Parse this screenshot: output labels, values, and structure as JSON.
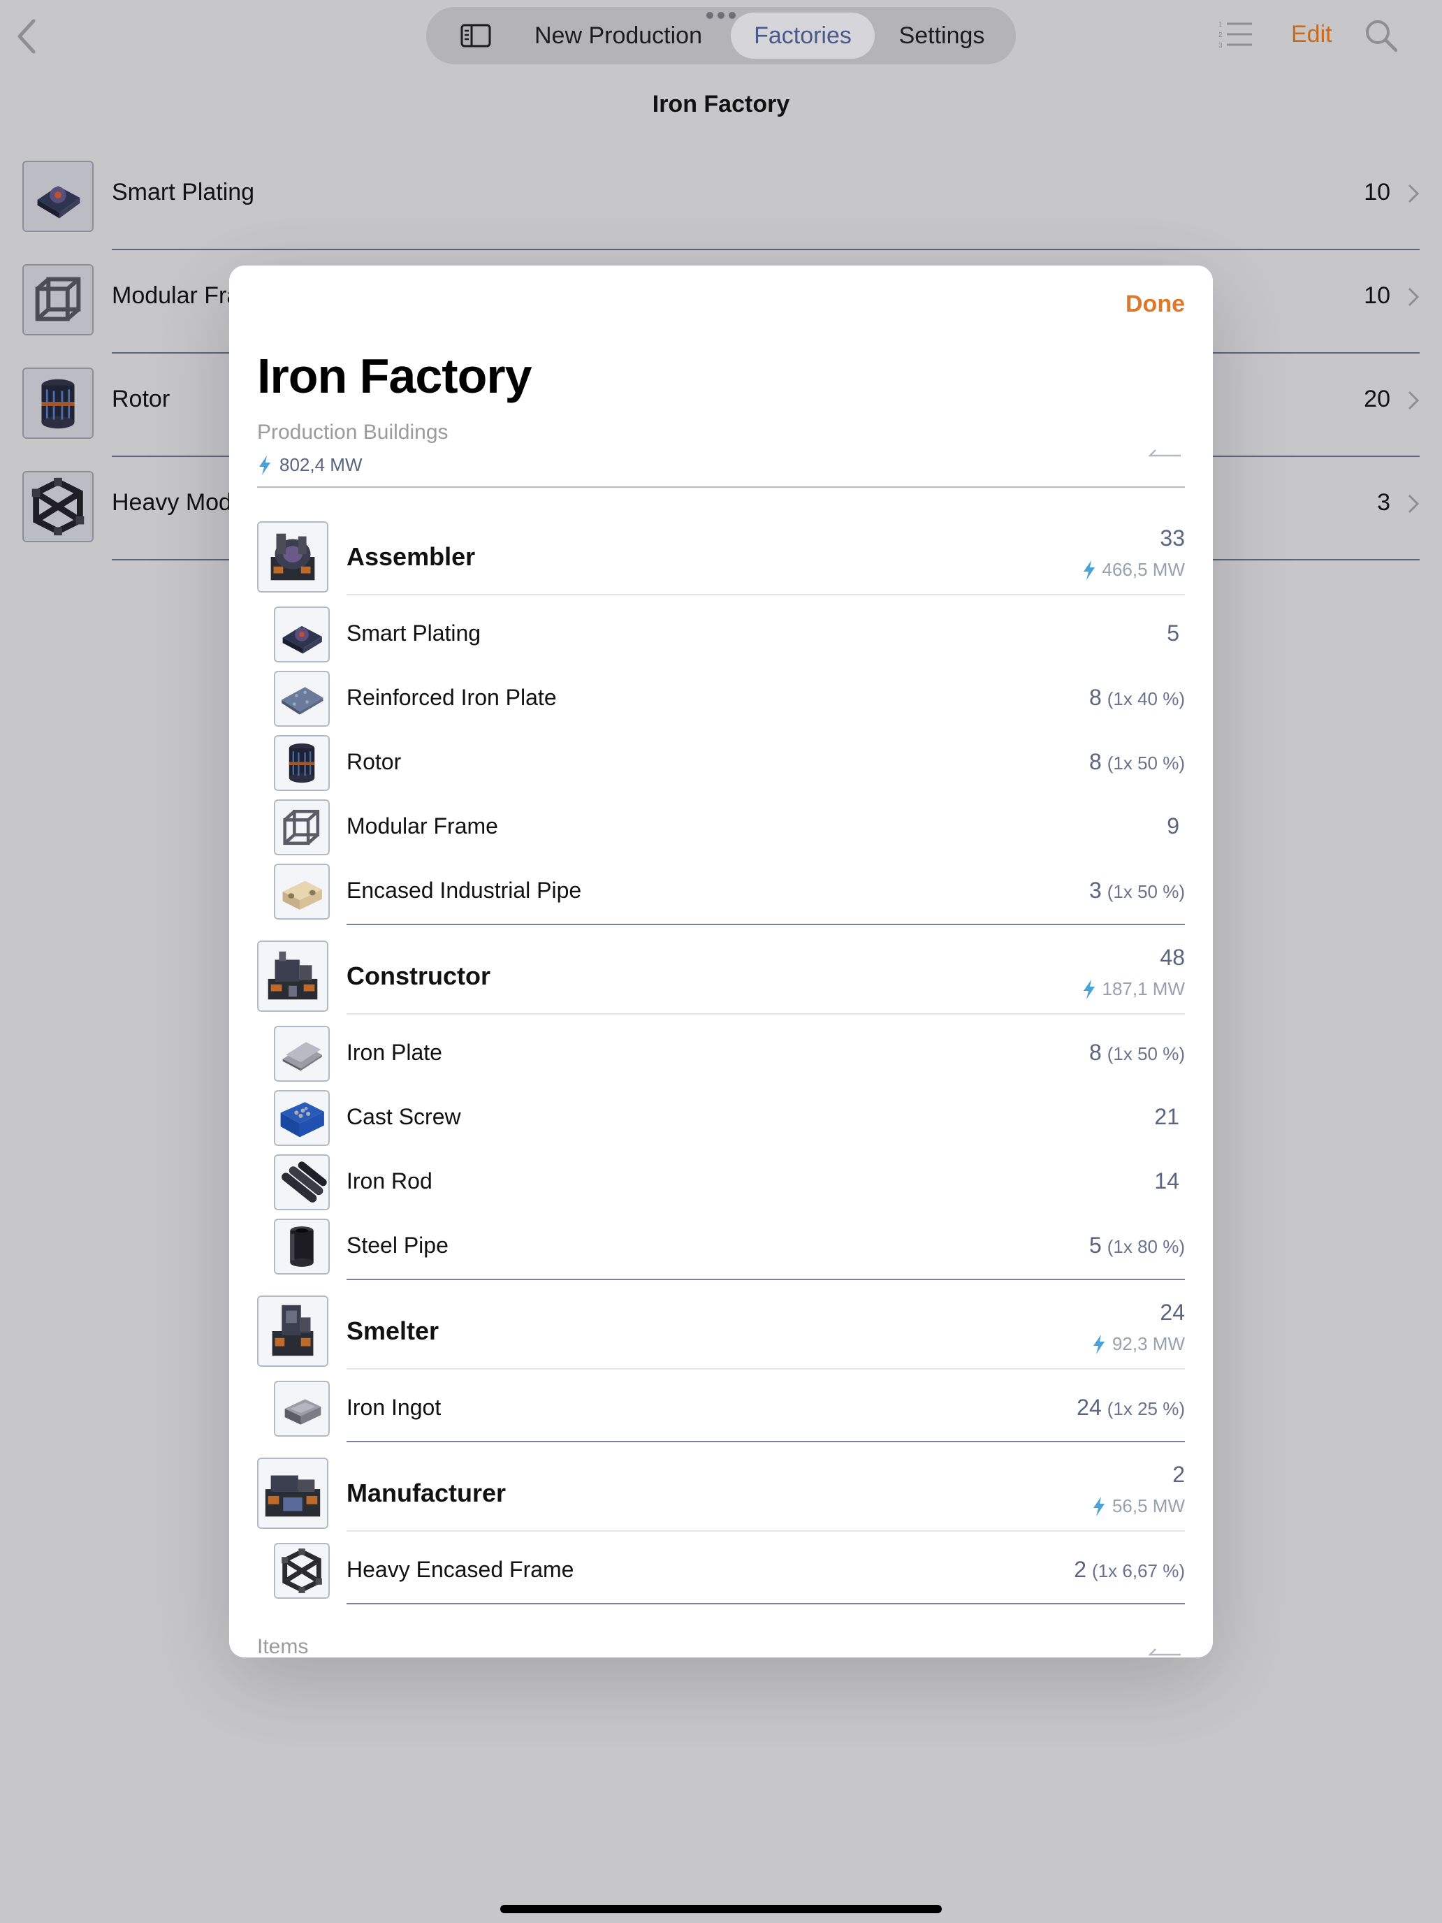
{
  "topbar": {
    "tabs": [
      "New Production",
      "Factories",
      "Settings"
    ],
    "selected_tab": "Factories",
    "edit_label": "Edit",
    "accent_color": "#c96a1e"
  },
  "background": {
    "title": "Iron Factory",
    "rows": [
      {
        "label": "Smart Plating",
        "value": "10",
        "icon": "smart-plating"
      },
      {
        "label": "Modular Fra",
        "value": "10",
        "icon": "modular-frame"
      },
      {
        "label": "Rotor",
        "value": "20",
        "icon": "rotor"
      },
      {
        "label": "Heavy Mod",
        "value": "3",
        "icon": "heavy-frame"
      }
    ]
  },
  "modal": {
    "done_label": "Done",
    "title": "Iron Factory",
    "section_production": "Production Buildings",
    "total_power": "802,4 MW",
    "section_items": "Items",
    "buildings": [
      {
        "name": "Assembler",
        "count": "33",
        "power": "466,5 MW",
        "icon": "assembler",
        "items": [
          {
            "name": "Smart Plating",
            "count": "5",
            "pct": "",
            "icon": "smart-plating"
          },
          {
            "name": "Reinforced Iron Plate",
            "count": "8",
            "pct": "(1x 40 %)",
            "icon": "reinforced-plate"
          },
          {
            "name": "Rotor",
            "count": "8",
            "pct": "(1x 50 %)",
            "icon": "rotor"
          },
          {
            "name": "Modular Frame",
            "count": "9",
            "pct": "",
            "icon": "modular-frame"
          },
          {
            "name": "Encased Industrial Pipe",
            "count": "3",
            "pct": "(1x 50 %)",
            "icon": "encased-pipe"
          }
        ]
      },
      {
        "name": "Constructor",
        "count": "48",
        "power": "187,1 MW",
        "icon": "constructor",
        "items": [
          {
            "name": "Iron Plate",
            "count": "8",
            "pct": "(1x 50 %)",
            "icon": "iron-plate"
          },
          {
            "name": "Cast Screw",
            "count": "21",
            "pct": "",
            "icon": "screw"
          },
          {
            "name": "Iron Rod",
            "count": "14",
            "pct": "",
            "icon": "iron-rod"
          },
          {
            "name": "Steel Pipe",
            "count": "5",
            "pct": "(1x 80 %)",
            "icon": "steel-pipe"
          }
        ]
      },
      {
        "name": "Smelter",
        "count": "24",
        "power": "92,3 MW",
        "icon": "smelter",
        "items": [
          {
            "name": "Iron Ingot",
            "count": "24",
            "pct": "(1x 25 %)",
            "icon": "iron-ingot"
          }
        ]
      },
      {
        "name": "Manufacturer",
        "count": "2",
        "power": "56,5 MW",
        "icon": "manufacturer",
        "items": [
          {
            "name": "Heavy Encased Frame",
            "count": "2",
            "pct": "(1x 6,67 %)",
            "icon": "heavy-frame"
          }
        ]
      }
    ]
  }
}
